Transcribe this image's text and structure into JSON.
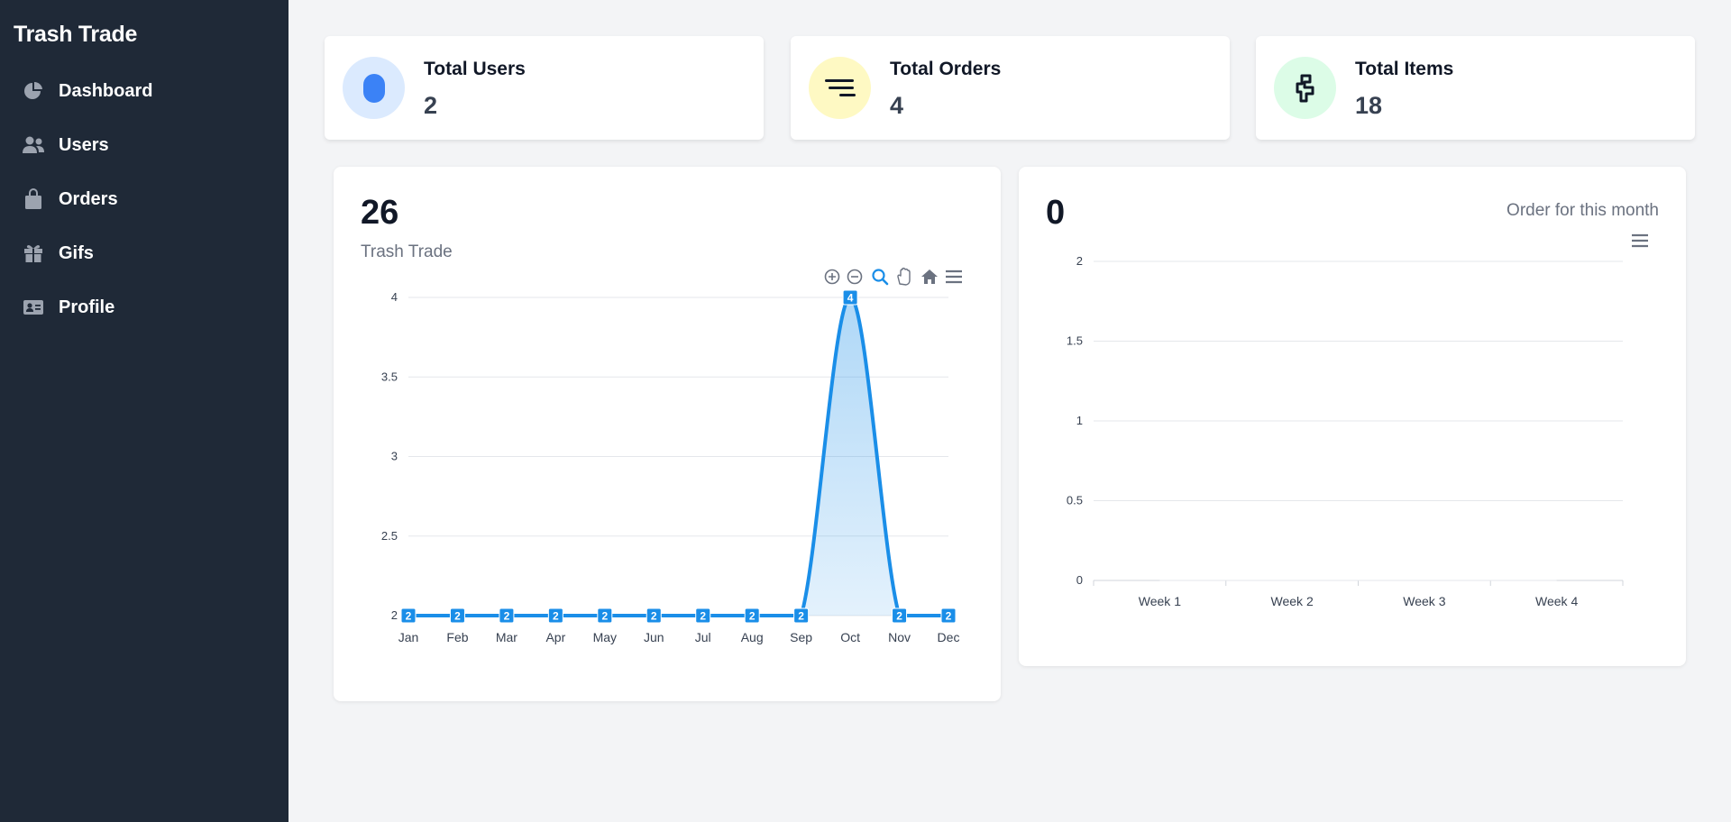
{
  "app": {
    "title": "Trash Trade"
  },
  "sidebar": {
    "items": [
      {
        "label": "Dashboard",
        "icon": "pie-chart-icon"
      },
      {
        "label": "Users",
        "icon": "users-icon"
      },
      {
        "label": "Orders",
        "icon": "shopping-bag-icon"
      },
      {
        "label": "Gifs",
        "icon": "gift-icon"
      },
      {
        "label": "Profile",
        "icon": "id-card-icon"
      }
    ]
  },
  "stats": [
    {
      "title": "Total Users",
      "value": "2",
      "icon": "user-pill-icon",
      "color": "#dbeafe",
      "accent": "#3b82f6"
    },
    {
      "title": "Total Orders",
      "value": "4",
      "icon": "lines-icon",
      "color": "#fef9c3",
      "accent": "#111827"
    },
    {
      "title": "Total Items",
      "value": "18",
      "icon": "puzzle-icon",
      "color": "#dcfce7",
      "accent": "#111827"
    }
  ],
  "yearly": {
    "total": "26",
    "subtitle": "Trash Trade"
  },
  "monthly": {
    "total": "0",
    "subtitle": "Order for this month"
  },
  "chart_data": [
    {
      "type": "area",
      "title": "",
      "categories": [
        "Jan",
        "Feb",
        "Mar",
        "Apr",
        "May",
        "Jun",
        "Jul",
        "Aug",
        "Sep",
        "Oct",
        "Nov",
        "Dec"
      ],
      "series": [
        {
          "values": [
            2,
            2,
            2,
            2,
            2,
            2,
            2,
            2,
            2,
            4,
            2,
            2
          ]
        }
      ],
      "yticks": [
        "2",
        "2.5",
        "3",
        "3.5",
        "4"
      ],
      "ylim": [
        2,
        4
      ],
      "grid": true,
      "color": "#1a8ee8",
      "data_labels": true,
      "toolbar": [
        "zoom-in-icon",
        "zoom-out-icon",
        "magnify-icon",
        "pan-icon",
        "home-icon",
        "menu-icon"
      ]
    },
    {
      "type": "line",
      "title": "",
      "categories": [
        "Week 1",
        "Week 2",
        "Week 3",
        "Week 4"
      ],
      "series": [
        {
          "values": [
            0,
            0,
            0,
            0
          ]
        }
      ],
      "yticks": [
        "0",
        "0.5",
        "1",
        "1.5",
        "2"
      ],
      "ylim": [
        0,
        2
      ],
      "grid": true,
      "toolbar": [
        "menu-icon"
      ]
    }
  ]
}
